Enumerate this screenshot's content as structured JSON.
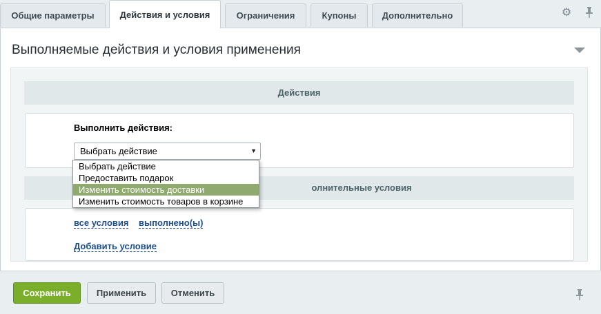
{
  "tabs": [
    {
      "label": "Общие параметры"
    },
    {
      "label": "Действия и условия"
    },
    {
      "label": "Ограничения"
    },
    {
      "label": "Купоны"
    },
    {
      "label": "Дополнительно"
    }
  ],
  "toolbar": {
    "settings_icon": "gear-icon",
    "pin_icon": "pin-icon"
  },
  "panel": {
    "title": "Выполняемые действия и условия применения"
  },
  "actions": {
    "heading": "Действия",
    "label": "Выполнить действия:",
    "select_value": "Выбрать действие",
    "options": [
      {
        "label": "Выбрать действие"
      },
      {
        "label": "Предоставить подарок"
      },
      {
        "label": "Изменить стоимость доставки"
      },
      {
        "label": "Изменить стоимость товаров в корзине"
      }
    ],
    "highlighted_option": "Изменить стоимость доставки"
  },
  "conditions": {
    "heading_visible": "олнительные условия",
    "all_conditions": "все условия",
    "fulfilled": "выполнено(ы)",
    "add_condition": "Добавить условие"
  },
  "footer": {
    "save": "Сохранить",
    "apply": "Применить",
    "cancel": "Отменить"
  },
  "colors": {
    "accent_green": "#7bae2a",
    "highlight": "#8fa96e",
    "link": "#1e4e8a"
  }
}
